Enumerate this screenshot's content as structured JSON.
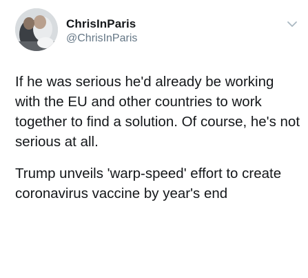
{
  "tweet": {
    "author": {
      "display_name": "ChrisInParis",
      "handle": "@ChrisInParis",
      "avatar_icon": "profile-photo"
    },
    "menu_icon": "chevron-down-icon",
    "paragraphs": [
      "If he was serious he'd already be working with the EU and other countries to work together to find a solution. Of course, he's not serious at all.",
      "Trump unveils 'warp-speed' effort to create coronavirus vaccine by year's end"
    ]
  },
  "colors": {
    "text_primary": "#14171a",
    "text_secondary": "#657786",
    "background": "#ffffff"
  }
}
